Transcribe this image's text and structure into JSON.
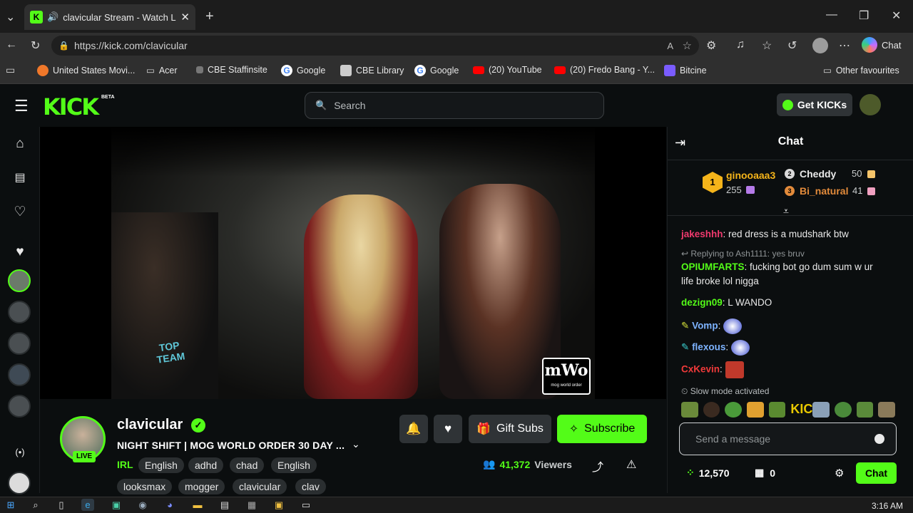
{
  "browser": {
    "tab_title": "clavicular Stream - Watch Live",
    "url": "https://kick.com/clavicular",
    "chat_button": "Chat",
    "favourites": [
      {
        "label": "United States Movi...",
        "color": "#f0782a"
      },
      {
        "label": "Acer",
        "color": "#999999"
      },
      {
        "label": "CBE Staffinsite",
        "color": "#777777"
      },
      {
        "label": "Google",
        "color": "#4285f4"
      },
      {
        "label": "CBE Library",
        "color": "#cccccc"
      },
      {
        "label": "Google",
        "color": "#4285f4"
      },
      {
        "label": "(20) YouTube",
        "color": "#ff0000"
      },
      {
        "label": "(20) Fredo Bang - Y...",
        "color": "#ff0000"
      },
      {
        "label": "Bitcine",
        "color": "#7a5cff"
      }
    ],
    "other_favourites": "Other favourites"
  },
  "kick": {
    "logo": "KICK",
    "beta": "BETA",
    "search_placeholder": "Search",
    "get_kicks": "Get KICKs",
    "brand_color": "#53fc18"
  },
  "stream": {
    "channel": "clavicular",
    "live_badge": "LIVE",
    "title": "NIGHT SHIFT | MOG WORLD ORDER 30 DAY ...",
    "category": "IRL",
    "tags_row1": [
      "English",
      "adhd",
      "chad",
      "English"
    ],
    "tags_row2": [
      "looksmax",
      "mogger",
      "clavicular",
      "clav"
    ],
    "gift_subs": "Gift Subs",
    "subscribe": "Subscribe",
    "viewers_count": "41,372",
    "viewers_label": "Viewers",
    "watermark_left": "TOP TEAM",
    "watermark_right": "mWo",
    "watermark_right_sub": "mog world order"
  },
  "chat": {
    "title": "Chat",
    "leaderboard": [
      {
        "rank": "1",
        "name": "ginooaaa3",
        "count": "255"
      },
      {
        "rank": "2",
        "name": "Cheddy",
        "count": "50"
      },
      {
        "rank": "3",
        "name": "Bi_natural",
        "count": "41"
      }
    ],
    "messages": [
      {
        "user": "jakeshhh",
        "color": "#f03a6e",
        "text": "red dress is a mudshark btw"
      },
      {
        "reply": "Replying to Ash1111: yes bruv"
      },
      {
        "user": "OPIUMFARTS",
        "color": "#53fc18",
        "text": "fucking bot go dum sum w ur",
        "text2": "life broke lol nigga"
      },
      {
        "user": "dezign09",
        "color": "#53fc18",
        "text": "L WANDO"
      },
      {
        "user": "Vomp",
        "color": "#7db3ff",
        "text": ""
      },
      {
        "user": "flexous",
        "color": "#7db3ff",
        "text": ""
      },
      {
        "user": "CxKevin",
        "color": "#f03a3a",
        "text": ""
      }
    ],
    "slow_mode": "Slow mode activated",
    "send_placeholder": "Send a message",
    "kicks_balance": "12,570",
    "shop_count": "0",
    "chat_button": "Chat"
  },
  "taskbar": {
    "time": "3:16 AM"
  }
}
